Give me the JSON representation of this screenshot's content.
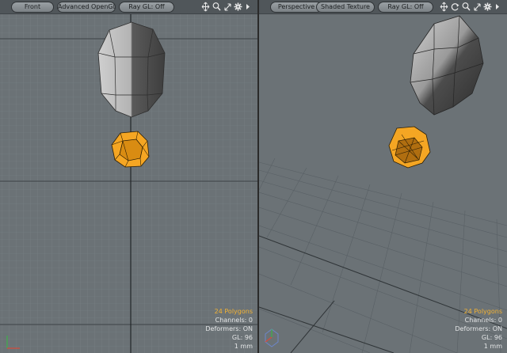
{
  "left_viewport": {
    "view_label": "Front",
    "shading_label": "Advanced OpenGL",
    "raygl_label": "Ray GL: Off",
    "stats": {
      "polygons": "24 Polygons",
      "channels": "Channels: 0",
      "deformers": "Deformers: ON",
      "gl": "GL: 96",
      "scale": "1 mm"
    }
  },
  "right_viewport": {
    "view_label": "Perspective",
    "shading_label": "Shaded Texture",
    "raygl_label": "Ray GL: Off",
    "stats": {
      "polygons": "24 Polygons",
      "channels": "Channels: 0",
      "deformers": "Deformers: ON",
      "gl": "GL: 96",
      "scale": "1 mm"
    }
  },
  "colors": {
    "viewport_bg": "#6b7276",
    "header_bg": "#50565a",
    "selection": "#f5a623",
    "highlight_text": "#f2b234"
  },
  "icons": [
    "move-icon",
    "zoom-icon",
    "fit-icon",
    "settings-icon",
    "menu-arrow-icon",
    "rotate-icon"
  ]
}
